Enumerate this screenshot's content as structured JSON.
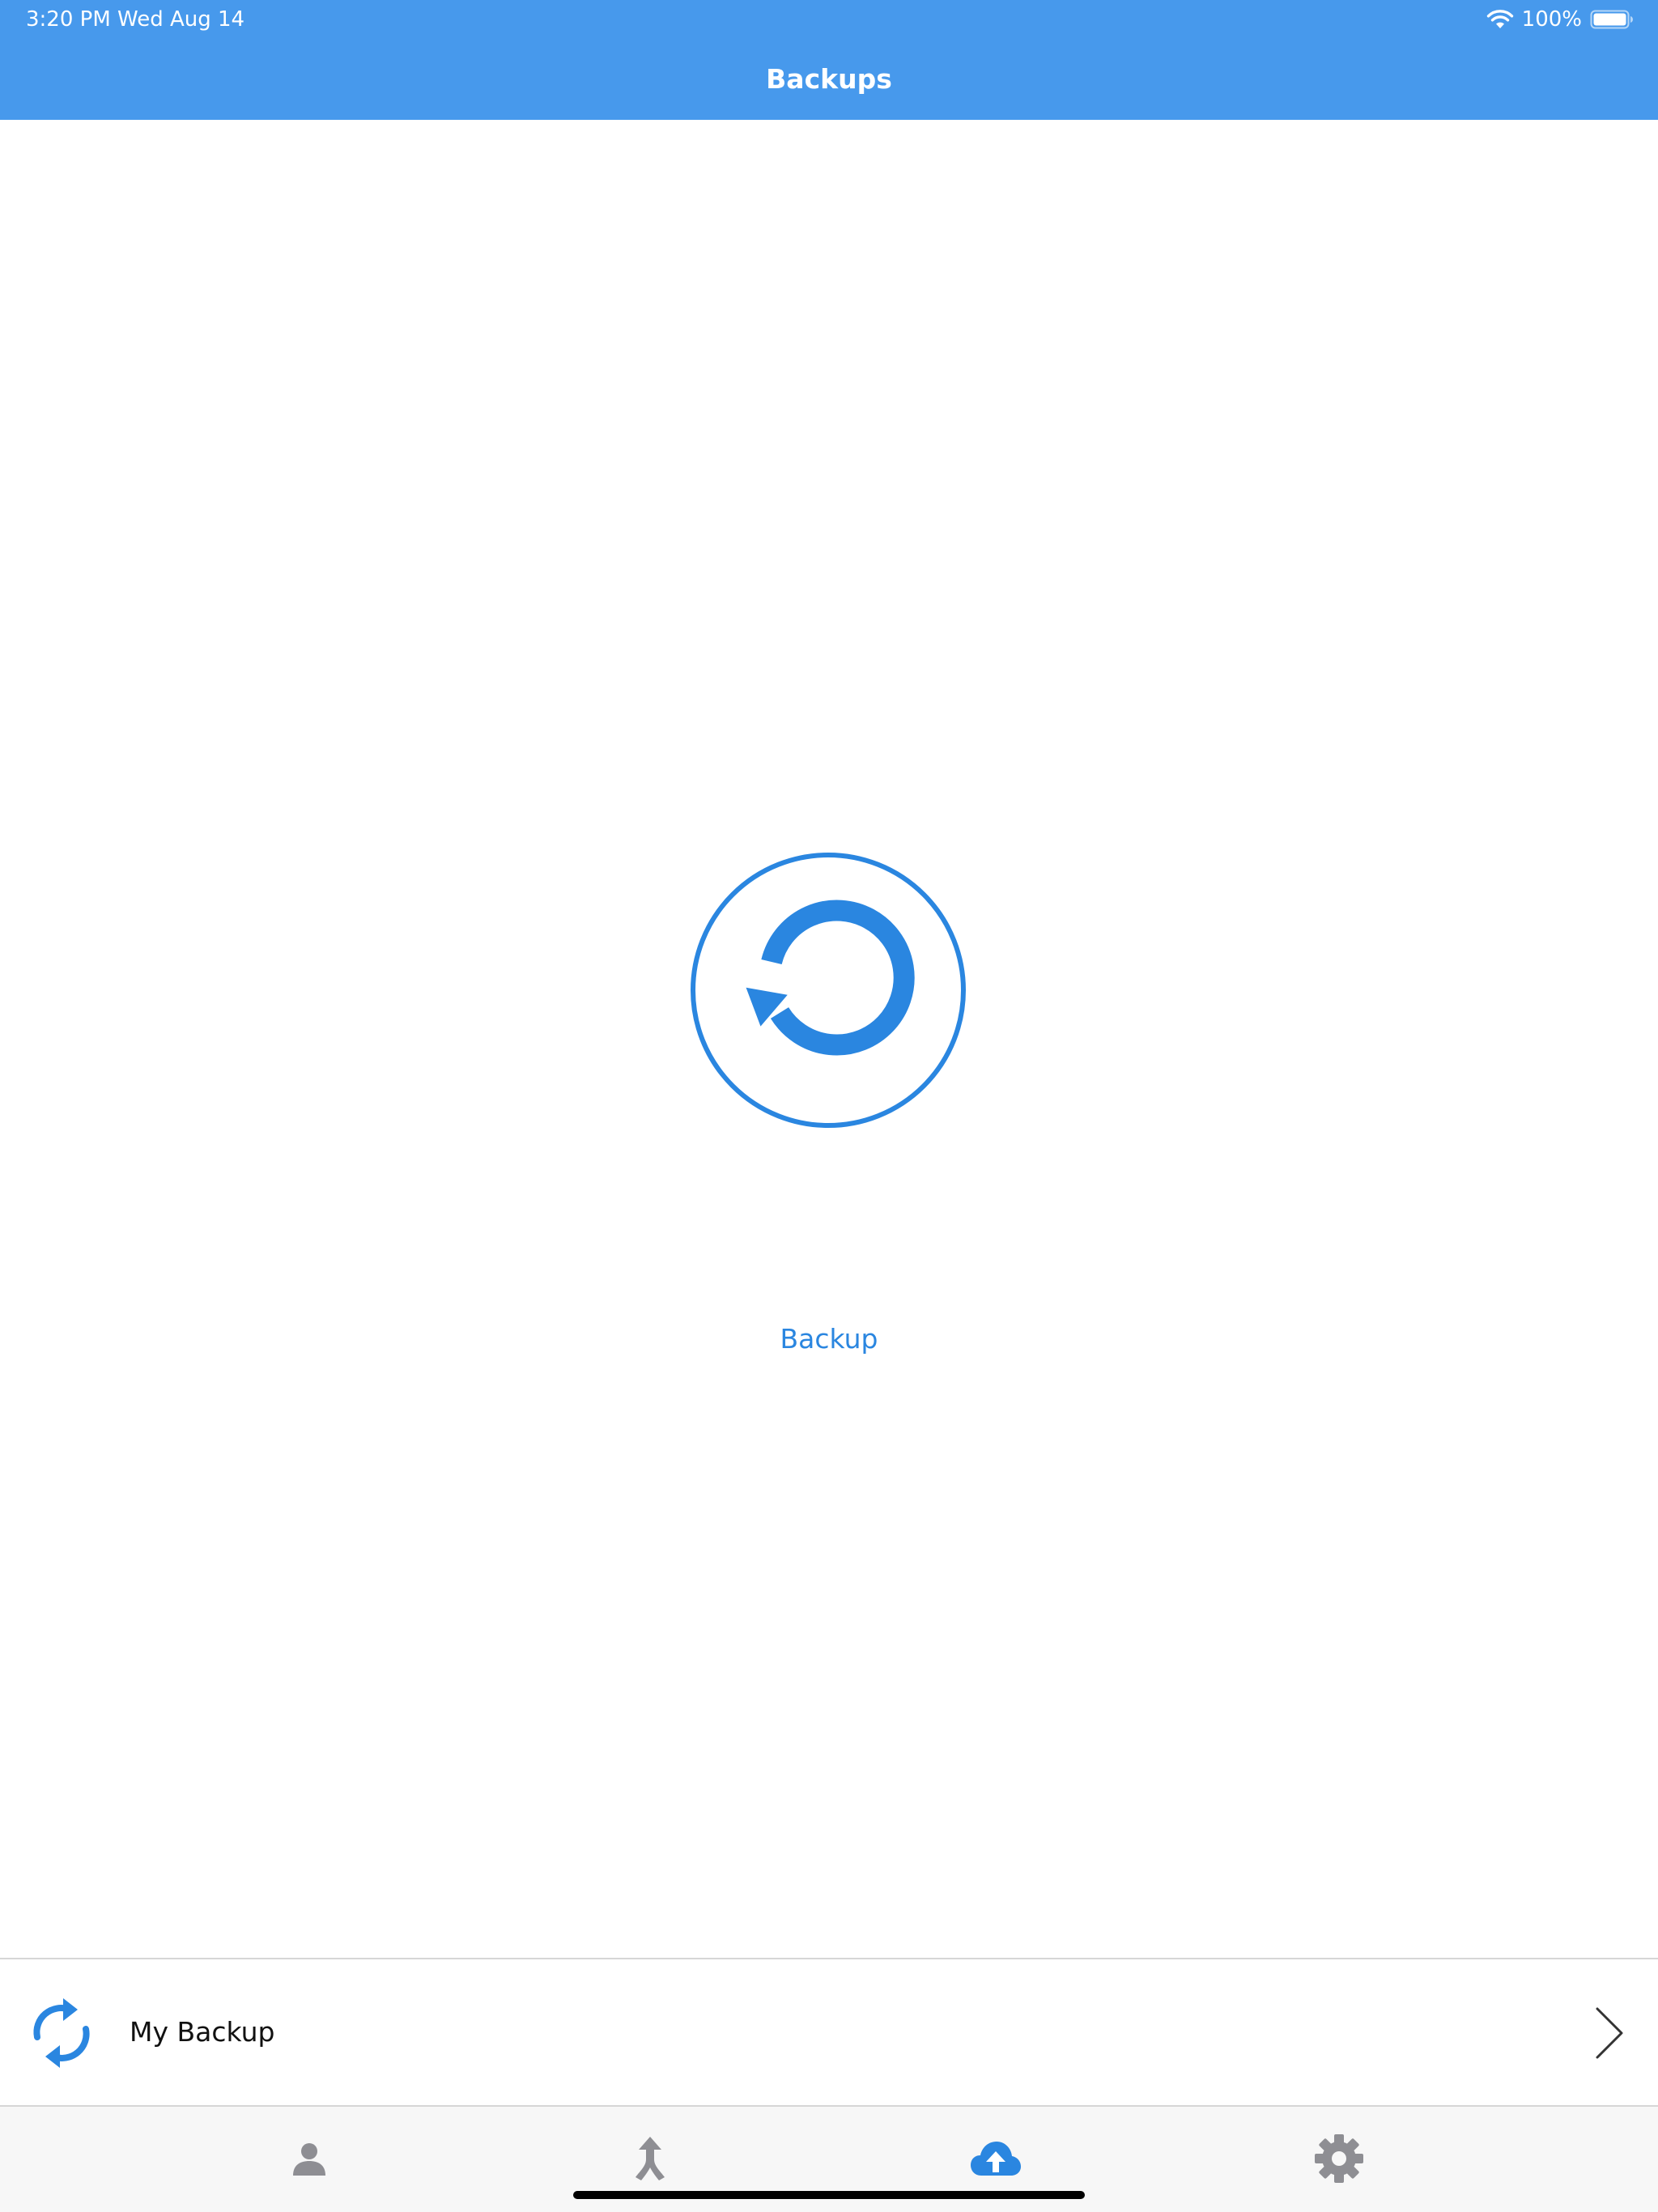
{
  "status_bar": {
    "time_date": "3:20 PM   Wed Aug 14",
    "battery": "100%"
  },
  "header": {
    "title": "Backups"
  },
  "main": {
    "action_label": "Backup"
  },
  "list": {
    "item_label": "My Backup"
  },
  "tabs": [
    {
      "icon": "person-icon",
      "active": false
    },
    {
      "icon": "merge-arrow-icon",
      "active": false
    },
    {
      "icon": "cloud-upload-icon",
      "active": true
    },
    {
      "icon": "gear-icon",
      "active": false
    }
  ],
  "colors": {
    "header_bg": "#4799EC",
    "accent": "#2A86E0",
    "tab_inactive": "#8E8E93",
    "tab_active": "#2A86E0"
  }
}
